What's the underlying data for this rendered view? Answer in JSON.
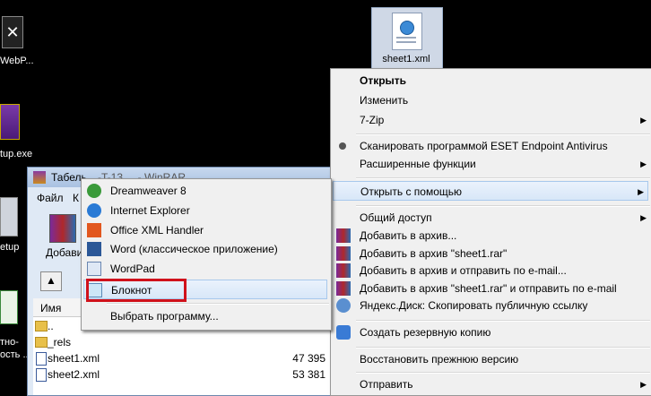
{
  "desktop": {
    "icons": [
      {
        "label": "WebP..."
      },
      {
        "label": "tup.exe"
      },
      {
        "label": "etup"
      },
      {
        "label": "тно-"
      },
      {
        "label": "ость ..."
      }
    ],
    "selected_file": {
      "label": "sheet1.xml"
    }
  },
  "winrar": {
    "title": "Табель",
    "title_rest": "-T-13 ... - WinRAR",
    "menu": [
      "Файл",
      "К"
    ],
    "toolbar_add": "Добави",
    "list_header": "Имя",
    "files": [
      {
        "name": "..",
        "size": ""
      },
      {
        "name": "_rels",
        "size": ""
      },
      {
        "name": "sheet1.xml",
        "size": "47 395"
      },
      {
        "name": "sheet2.xml",
        "size": "53 381"
      }
    ]
  },
  "context_menu": {
    "items": [
      {
        "label": "Открыть",
        "bold": true
      },
      {
        "label": "Изменить"
      },
      {
        "label": "7-Zip",
        "submenu": true
      },
      {
        "label": "Сканировать программой ESET Endpoint Antivirus"
      },
      {
        "label": "Расширенные функции",
        "submenu": true
      },
      {
        "label": "Открыть с помощью",
        "submenu": true
      },
      {
        "label": "Общий доступ",
        "submenu": true
      },
      {
        "label": "Добавить в архив..."
      },
      {
        "label": "Добавить в архив \"sheet1.rar\""
      },
      {
        "label": "Добавить в архив и отправить по e-mail..."
      },
      {
        "label": "Добавить в архив \"sheet1.rar\" и отправить по e-mail"
      },
      {
        "label": "Яндекс.Диск: Скопировать публичную ссылку"
      },
      {
        "label": "Создать резервную копию"
      },
      {
        "label": "Восстановить прежнюю версию"
      },
      {
        "label": "Отправить",
        "submenu": true
      }
    ]
  },
  "open_with_menu": {
    "items": [
      {
        "label": "Dreamweaver 8",
        "icon": "dreamweaver-icon"
      },
      {
        "label": "Internet Explorer",
        "icon": "internet-explorer-icon"
      },
      {
        "label": "Office XML Handler",
        "icon": "office-icon"
      },
      {
        "label": "Word (классическое приложение)",
        "icon": "word-icon"
      },
      {
        "label": "WordPad",
        "icon": "wordpad-icon"
      },
      {
        "label": "Блокнот",
        "icon": "notepad-icon",
        "highlighted": true
      }
    ],
    "choose": "Выбрать программу..."
  },
  "colors": {
    "highlight_box": "#d0111b"
  }
}
